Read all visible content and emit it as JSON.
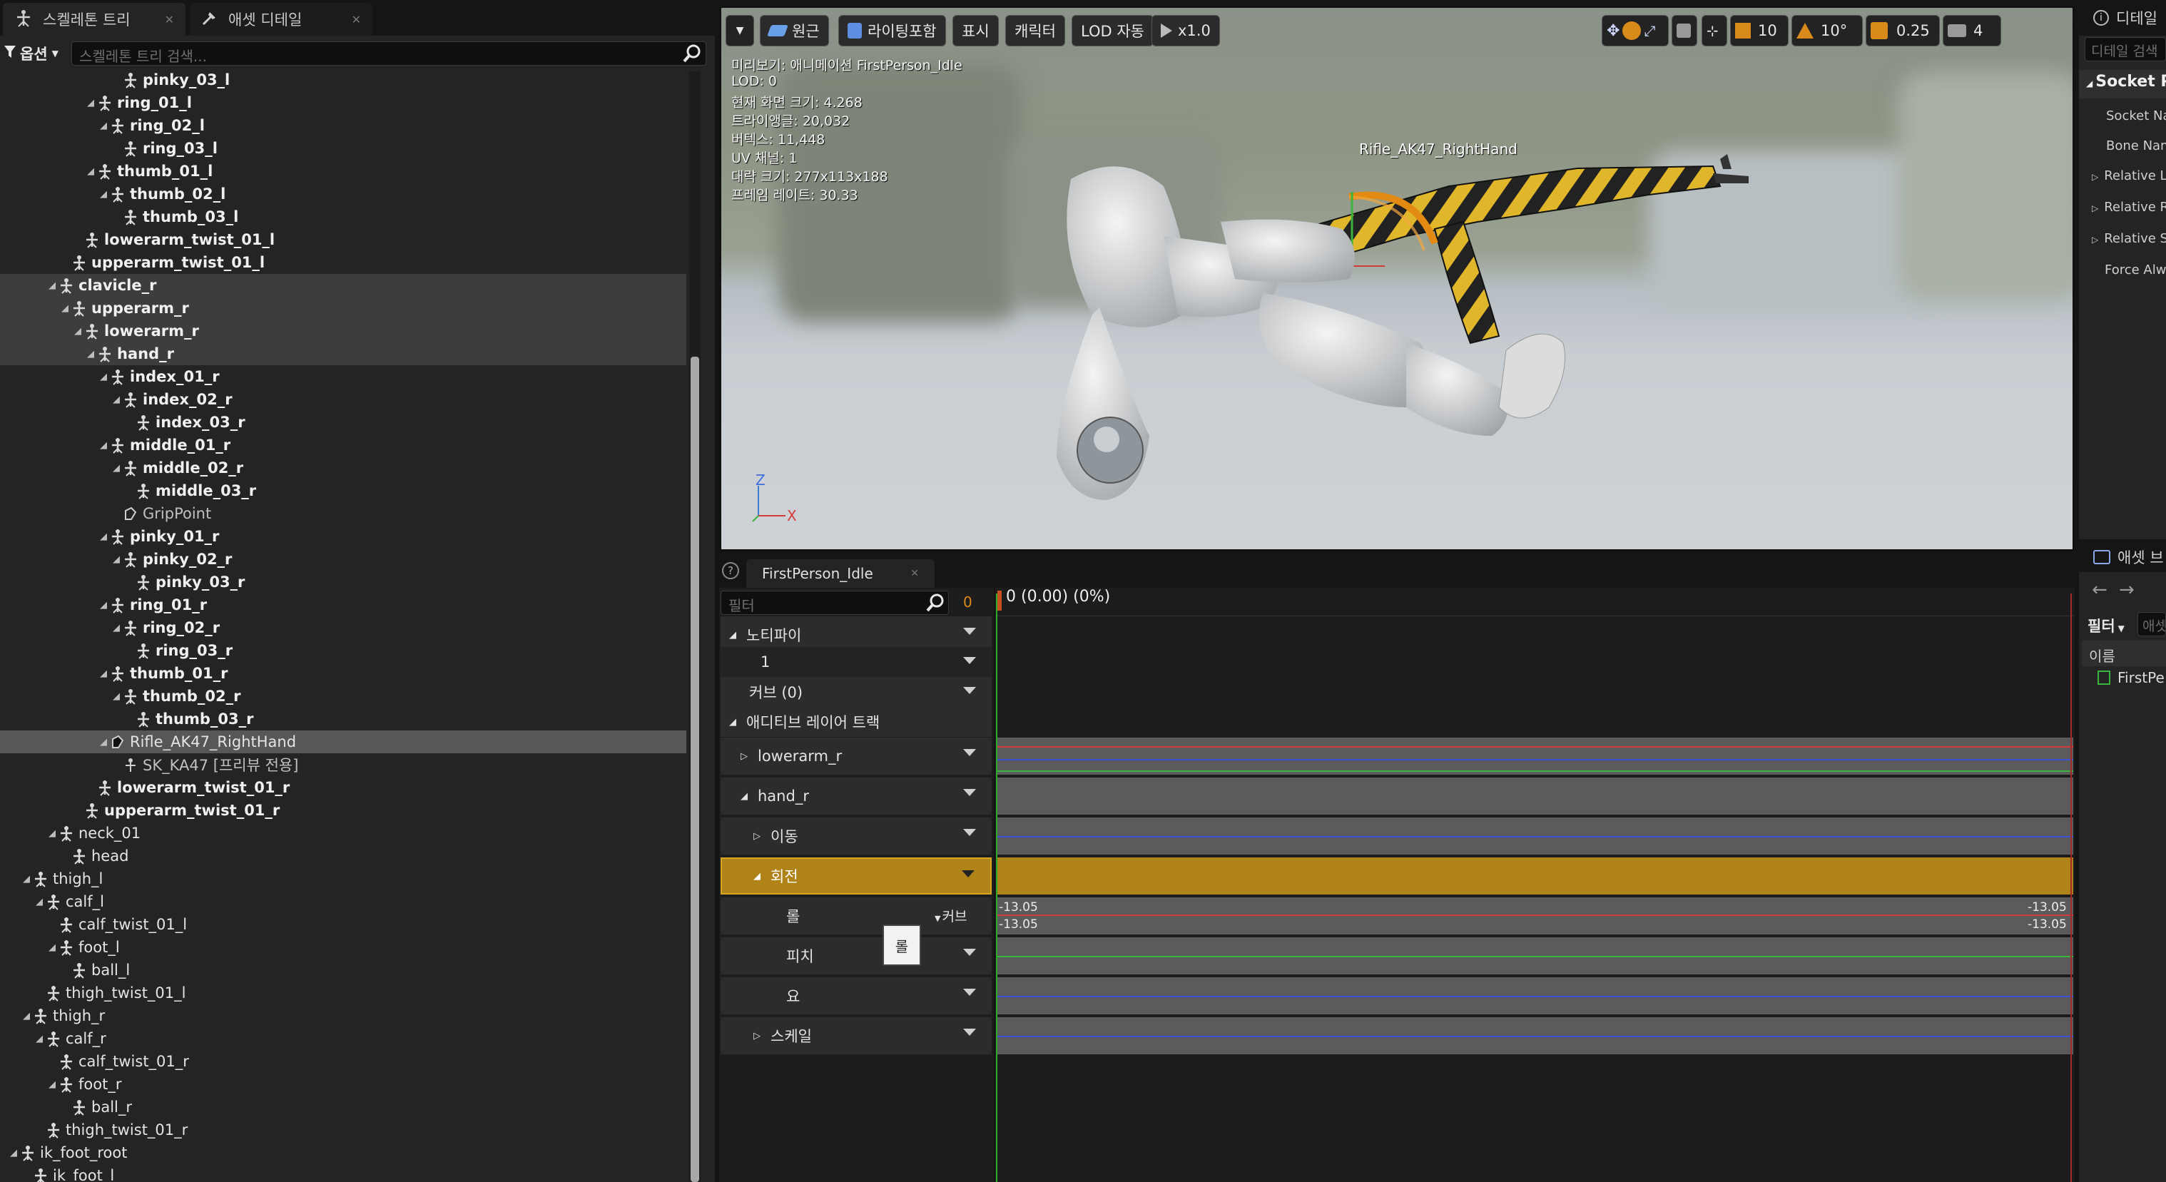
{
  "skeleton_panel": {
    "tabs": [
      {
        "label": "스켈레톤 트리",
        "active": true
      },
      {
        "label": "애셋 디테일",
        "active": false
      }
    ],
    "options_label": "옵션",
    "search_placeholder": "스켈레톤 트리 검색...",
    "rows": [
      {
        "label": "pinky_03_l",
        "depth": 8,
        "tw": "",
        "style": "bold"
      },
      {
        "label": "ring_01_l",
        "depth": 6,
        "tw": "◢",
        "style": "bold"
      },
      {
        "label": "ring_02_l",
        "depth": 7,
        "tw": "◢",
        "style": "bold"
      },
      {
        "label": "ring_03_l",
        "depth": 8,
        "tw": "",
        "style": "bold"
      },
      {
        "label": "thumb_01_l",
        "depth": 6,
        "tw": "◢",
        "style": "bold"
      },
      {
        "label": "thumb_02_l",
        "depth": 7,
        "tw": "◢",
        "style": "bold"
      },
      {
        "label": "thumb_03_l",
        "depth": 8,
        "tw": "",
        "style": "bold"
      },
      {
        "label": "lowerarm_twist_01_l",
        "depth": 5,
        "tw": "",
        "style": "bold"
      },
      {
        "label": "upperarm_twist_01_l",
        "depth": 4,
        "tw": "",
        "style": "bold"
      },
      {
        "label": "clavicle_r",
        "depth": 3,
        "tw": "◢",
        "style": "bold",
        "sel": true
      },
      {
        "label": "upperarm_r",
        "depth": 4,
        "tw": "◢",
        "style": "bold",
        "sel": true
      },
      {
        "label": "lowerarm_r",
        "depth": 5,
        "tw": "◢",
        "style": "bold",
        "sel": true
      },
      {
        "label": "hand_r",
        "depth": 6,
        "tw": "◢",
        "style": "bold",
        "sel": true
      },
      {
        "label": "index_01_r",
        "depth": 7,
        "tw": "◢",
        "style": "bold"
      },
      {
        "label": "index_02_r",
        "depth": 8,
        "tw": "◢",
        "style": "bold"
      },
      {
        "label": "index_03_r",
        "depth": 9,
        "tw": "",
        "style": "bold"
      },
      {
        "label": "middle_01_r",
        "depth": 7,
        "tw": "◢",
        "style": "bold"
      },
      {
        "label": "middle_02_r",
        "depth": 8,
        "tw": "◢",
        "style": "bold"
      },
      {
        "label": "middle_03_r",
        "depth": 9,
        "tw": "",
        "style": "bold"
      },
      {
        "label": "GripPoint",
        "depth": 8,
        "tw": "",
        "style": "soft",
        "icon": "socket"
      },
      {
        "label": "pinky_01_r",
        "depth": 7,
        "tw": "◢",
        "style": "bold"
      },
      {
        "label": "pinky_02_r",
        "depth": 8,
        "tw": "◢",
        "style": "bold"
      },
      {
        "label": "pinky_03_r",
        "depth": 9,
        "tw": "",
        "style": "bold"
      },
      {
        "label": "ring_01_r",
        "depth": 7,
        "tw": "◢",
        "style": "bold"
      },
      {
        "label": "ring_02_r",
        "depth": 8,
        "tw": "◢",
        "style": "bold"
      },
      {
        "label": "ring_03_r",
        "depth": 9,
        "tw": "",
        "style": "bold"
      },
      {
        "label": "thumb_01_r",
        "depth": 7,
        "tw": "◢",
        "style": "bold"
      },
      {
        "label": "thumb_02_r",
        "depth": 8,
        "tw": "◢",
        "style": "bold"
      },
      {
        "label": "thumb_03_r",
        "depth": 9,
        "tw": "",
        "style": "bold"
      },
      {
        "label": "Rifle_AK47_RightHand",
        "depth": 7,
        "tw": "◢",
        "style": "normal",
        "sel2": true,
        "icon": "socket-filled"
      },
      {
        "label": "SK_KA47 [프리뷰 전용]",
        "depth": 8,
        "tw": "",
        "style": "soft",
        "icon": "mesh"
      },
      {
        "label": "lowerarm_twist_01_r",
        "depth": 6,
        "tw": "",
        "style": "bold"
      },
      {
        "label": "upperarm_twist_01_r",
        "depth": 5,
        "tw": "",
        "style": "bold"
      },
      {
        "label": "neck_01",
        "depth": 3,
        "tw": "◢",
        "style": "normal"
      },
      {
        "label": "head",
        "depth": 4,
        "tw": "",
        "style": "normal"
      },
      {
        "label": "thigh_l",
        "depth": 1,
        "tw": "◢",
        "style": "normal"
      },
      {
        "label": "calf_l",
        "depth": 2,
        "tw": "◢",
        "style": "normal"
      },
      {
        "label": "calf_twist_01_l",
        "depth": 3,
        "tw": "",
        "style": "normal"
      },
      {
        "label": "foot_l",
        "depth": 3,
        "tw": "◢",
        "style": "normal"
      },
      {
        "label": "ball_l",
        "depth": 4,
        "tw": "",
        "style": "normal"
      },
      {
        "label": "thigh_twist_01_l",
        "depth": 2,
        "tw": "",
        "style": "normal"
      },
      {
        "label": "thigh_r",
        "depth": 1,
        "tw": "◢",
        "style": "normal"
      },
      {
        "label": "calf_r",
        "depth": 2,
        "tw": "◢",
        "style": "normal"
      },
      {
        "label": "calf_twist_01_r",
        "depth": 3,
        "tw": "",
        "style": "normal"
      },
      {
        "label": "foot_r",
        "depth": 3,
        "tw": "◢",
        "style": "normal"
      },
      {
        "label": "ball_r",
        "depth": 4,
        "tw": "",
        "style": "normal"
      },
      {
        "label": "thigh_twist_01_r",
        "depth": 2,
        "tw": "",
        "style": "normal"
      },
      {
        "label": "ik_foot_root",
        "depth": 0,
        "tw": "◢",
        "style": "normal"
      },
      {
        "label": "ik_foot_l",
        "depth": 1,
        "tw": "",
        "style": "normal"
      },
      {
        "label": "ik_foot_r",
        "depth": 1,
        "tw": "",
        "style": "normal"
      }
    ]
  },
  "viewport": {
    "toolbar": {
      "perspective": "원근",
      "lighting": "라이팅포함",
      "show": "표시",
      "character": "캐릭터",
      "lod": "LOD 자동",
      "speed": "x1.0",
      "grid_snap": "10",
      "rot_snap": "10°",
      "scale_snap": "0.25",
      "camera_speed": "4"
    },
    "info_lines": [
      "미리보기: 애니메이션 FirstPerson_Idle",
      "LOD: 0",
      "현재 화면 크기: 4.268",
      "트라이앵글: 20,032",
      "버텍스: 11,448",
      "UV 채널: 1",
      "대략 크기: 277x113x188",
      "프레임 레이트: 30.33"
    ],
    "socket_label": "Rifle_AK47_RightHand",
    "axis_z": "Z",
    "axis_x": "X"
  },
  "details_panel": {
    "tab_label": "디테일",
    "search_placeholder": "디테일 검색",
    "section": "Socket P",
    "rows": [
      "Socket Na",
      "Bone Nam",
      "Relative Lo",
      "Relative R",
      "Relative S",
      "Force Alw"
    ]
  },
  "asset_browser": {
    "tab_label": "애셋 브",
    "filter_label": "필터",
    "filter_placeholder": "애셋",
    "name_header": "이름",
    "item": "FirstPe"
  },
  "anim_editor": {
    "tab_label": "FirstPerson_Idle",
    "filter_placeholder": "필터",
    "filter_count": "0",
    "time_readout": "0 (0.00) (0%)",
    "tracks": [
      {
        "label": "노티파이",
        "tw": "◢"
      },
      {
        "label": "1",
        "tw": ""
      },
      {
        "label": "커브  (0)",
        "tw": ""
      },
      {
        "label": "애디티브 레이어 트랙",
        "tw": "◢"
      },
      {
        "label": "lowerarm_r",
        "tw": "▷"
      },
      {
        "label": "hand_r",
        "tw": "◢"
      },
      {
        "label": "이동",
        "tw": "▷"
      },
      {
        "label": "회전",
        "tw": "◢"
      },
      {
        "label": "롤",
        "tw": ""
      },
      {
        "label": "피치",
        "tw": ""
      },
      {
        "label": "요",
        "tw": ""
      },
      {
        "label": "스케일",
        "tw": "▷"
      }
    ],
    "curve_label": "커브",
    "tooltip": "롤",
    "value_left_1": "-13.05",
    "value_left_2": "-13.05",
    "value_right_1": "-13.05",
    "value_right_2": "-13.05"
  },
  "colors": {
    "selection_gold": "#b08318",
    "accent_orange": "#d88a1a",
    "roll_red": "#d23b3b",
    "pitch_green": "#3bb43b",
    "yaw_blue": "#3b4fd2"
  }
}
